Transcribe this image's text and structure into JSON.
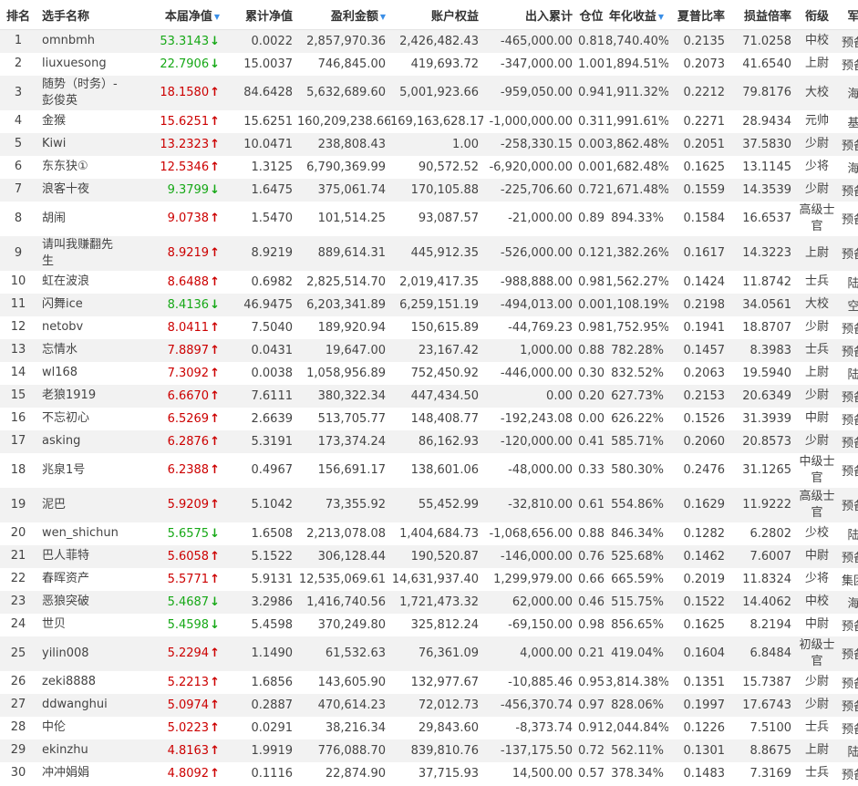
{
  "headers": {
    "rank": "排名",
    "name": "选手名称",
    "nav": "本届净值",
    "cum": "累计净值",
    "profit": "盈利金额",
    "equity": "账户权益",
    "inout": "出入累计",
    "pos": "仓位",
    "annual": "年化收益",
    "sharpe": "夏普比率",
    "plr": "损益倍率",
    "grade": "衔级",
    "branch": "军种"
  },
  "colors": {
    "up": "#cc0000",
    "down": "#16a816",
    "sort_icon": "#3a8ee6",
    "row_alt": "#f2f2f2"
  },
  "rows": [
    {
      "rank": "1",
      "name": "omnbmh",
      "nav": "53.3143",
      "dir": "down",
      "cum": "0.0022",
      "profit": "2,857,970.36",
      "equity": "2,426,482.43",
      "inout": "-465,000.00",
      "pos": "0.81",
      "annual": "8,740.40%",
      "sharpe": "0.2135",
      "plr": "71.0258",
      "grade": "中校",
      "branch": "预备役",
      "tall": false
    },
    {
      "rank": "2",
      "name": "liuxuesong",
      "nav": "22.7906",
      "dir": "down",
      "cum": "15.0037",
      "profit": "746,845.00",
      "equity": "419,693.72",
      "inout": "-347,000.00",
      "pos": "1.00",
      "annual": "1,894.51%",
      "sharpe": "0.2073",
      "plr": "41.6540",
      "grade": "上尉",
      "branch": "预备役",
      "tall": false
    },
    {
      "rank": "3",
      "name": "随势（时务）-彭俊英",
      "nav": "18.1580",
      "dir": "up",
      "cum": "84.6428",
      "profit": "5,632,689.60",
      "equity": "5,001,923.66",
      "inout": "-959,050.00",
      "pos": "0.94",
      "annual": "1,911.32%",
      "sharpe": "0.2212",
      "plr": "79.8176",
      "grade": "大校",
      "branch": "海军",
      "tall": true
    },
    {
      "rank": "4",
      "name": "金猴",
      "nav": "15.6251",
      "dir": "up",
      "cum": "15.6251",
      "profit": "160,209,238.66",
      "equity": "169,163,628.17",
      "inout": "-1,000,000.00",
      "pos": "0.31",
      "annual": "1,991.61%",
      "sharpe": "0.2271",
      "plr": "28.9434",
      "grade": "元帅",
      "branch": "基金",
      "tall": false
    },
    {
      "rank": "5",
      "name": "Kiwi",
      "nav": "13.2323",
      "dir": "up",
      "cum": "10.0471",
      "profit": "238,808.43",
      "equity": "1.00",
      "inout": "-258,330.15",
      "pos": "0.00",
      "annual": "3,862.48%",
      "sharpe": "0.2051",
      "plr": "37.5830",
      "grade": "少尉",
      "branch": "预备役",
      "tall": false
    },
    {
      "rank": "6",
      "name": "东东㹟①",
      "nav": "12.5346",
      "dir": "up",
      "cum": "1.3125",
      "profit": "6,790,369.99",
      "equity": "90,572.52",
      "inout": "-6,920,000.00",
      "pos": "0.00",
      "annual": "1,682.48%",
      "sharpe": "0.1625",
      "plr": "13.1145",
      "grade": "少将",
      "branch": "海军",
      "tall": false
    },
    {
      "rank": "7",
      "name": "浪客十夜",
      "nav": "9.3799",
      "dir": "down",
      "cum": "1.6475",
      "profit": "375,061.74",
      "equity": "170,105.88",
      "inout": "-225,706.60",
      "pos": "0.72",
      "annual": "1,671.48%",
      "sharpe": "0.1559",
      "plr": "14.3539",
      "grade": "少尉",
      "branch": "预备役",
      "tall": false
    },
    {
      "rank": "8",
      "name": "胡闹",
      "nav": "9.0738",
      "dir": "up",
      "cum": "1.5470",
      "profit": "101,514.25",
      "equity": "93,087.57",
      "inout": "-21,000.00",
      "pos": "0.89",
      "annual": "894.33%",
      "sharpe": "0.1584",
      "plr": "16.6537",
      "grade": "高级士官",
      "branch": "预备役",
      "tall": true
    },
    {
      "rank": "9",
      "name": "请叫我赚翻先生",
      "nav": "8.9219",
      "dir": "up",
      "cum": "8.9219",
      "profit": "889,614.31",
      "equity": "445,912.35",
      "inout": "-526,000.00",
      "pos": "0.12",
      "annual": "1,382.26%",
      "sharpe": "0.1617",
      "plr": "14.3223",
      "grade": "上尉",
      "branch": "预备役",
      "tall": true
    },
    {
      "rank": "10",
      "name": "虹在波浪",
      "nav": "8.6488",
      "dir": "up",
      "cum": "0.6982",
      "profit": "2,825,514.70",
      "equity": "2,019,417.35",
      "inout": "-988,888.00",
      "pos": "0.98",
      "annual": "1,562.27%",
      "sharpe": "0.1424",
      "plr": "11.8742",
      "grade": "士兵",
      "branch": "陆军",
      "tall": false
    },
    {
      "rank": "11",
      "name": "闪舞ice",
      "nav": "8.4136",
      "dir": "down",
      "cum": "46.9475",
      "profit": "6,203,341.89",
      "equity": "6,259,151.19",
      "inout": "-494,013.00",
      "pos": "0.00",
      "annual": "1,108.19%",
      "sharpe": "0.2198",
      "plr": "34.0561",
      "grade": "大校",
      "branch": "空军",
      "tall": false
    },
    {
      "rank": "12",
      "name": "netobv",
      "nav": "8.0411",
      "dir": "up",
      "cum": "7.5040",
      "profit": "189,920.94",
      "equity": "150,615.89",
      "inout": "-44,769.23",
      "pos": "0.98",
      "annual": "1,752.95%",
      "sharpe": "0.1941",
      "plr": "18.8707",
      "grade": "少尉",
      "branch": "预备役",
      "tall": false
    },
    {
      "rank": "13",
      "name": "忘情水",
      "nav": "7.8897",
      "dir": "up",
      "cum": "0.0431",
      "profit": "19,647.00",
      "equity": "23,167.42",
      "inout": "1,000.00",
      "pos": "0.88",
      "annual": "782.28%",
      "sharpe": "0.1457",
      "plr": "8.3983",
      "grade": "士兵",
      "branch": "预备役",
      "tall": false
    },
    {
      "rank": "14",
      "name": "wl168",
      "nav": "7.3092",
      "dir": "up",
      "cum": "0.0038",
      "profit": "1,058,956.89",
      "equity": "752,450.92",
      "inout": "-446,000.00",
      "pos": "0.30",
      "annual": "832.52%",
      "sharpe": "0.2063",
      "plr": "19.5940",
      "grade": "上尉",
      "branch": "陆军",
      "tall": false
    },
    {
      "rank": "15",
      "name": "老狼1919",
      "nav": "6.6670",
      "dir": "up",
      "cum": "7.6111",
      "profit": "380,322.34",
      "equity": "447,434.50",
      "inout": "0.00",
      "pos": "0.20",
      "annual": "627.73%",
      "sharpe": "0.2153",
      "plr": "20.6349",
      "grade": "少尉",
      "branch": "预备役",
      "tall": false
    },
    {
      "rank": "16",
      "name": "不忘初心",
      "nav": "6.5269",
      "dir": "up",
      "cum": "2.6639",
      "profit": "513,705.77",
      "equity": "148,408.77",
      "inout": "-192,243.08",
      "pos": "0.00",
      "annual": "626.22%",
      "sharpe": "0.1526",
      "plr": "31.3939",
      "grade": "中尉",
      "branch": "预备役",
      "tall": false
    },
    {
      "rank": "17",
      "name": "asking",
      "nav": "6.2876",
      "dir": "up",
      "cum": "5.3191",
      "profit": "173,374.24",
      "equity": "86,162.93",
      "inout": "-120,000.00",
      "pos": "0.41",
      "annual": "585.71%",
      "sharpe": "0.2060",
      "plr": "20.8573",
      "grade": "少尉",
      "branch": "预备役",
      "tall": false
    },
    {
      "rank": "18",
      "name": "兆泉1号",
      "nav": "6.2388",
      "dir": "up",
      "cum": "0.4967",
      "profit": "156,691.17",
      "equity": "138,601.06",
      "inout": "-48,000.00",
      "pos": "0.33",
      "annual": "580.30%",
      "sharpe": "0.2476",
      "plr": "31.1265",
      "grade": "中级士官",
      "branch": "预备役",
      "tall": true
    },
    {
      "rank": "19",
      "name": "泥巴",
      "nav": "5.9209",
      "dir": "up",
      "cum": "5.1042",
      "profit": "73,355.92",
      "equity": "55,452.99",
      "inout": "-32,810.00",
      "pos": "0.61",
      "annual": "554.86%",
      "sharpe": "0.1629",
      "plr": "11.9222",
      "grade": "高级士官",
      "branch": "预备役",
      "tall": true
    },
    {
      "rank": "20",
      "name": "wen_shichun",
      "nav": "5.6575",
      "dir": "down",
      "cum": "1.6508",
      "profit": "2,213,078.08",
      "equity": "1,404,684.73",
      "inout": "-1,068,656.00",
      "pos": "0.88",
      "annual": "846.34%",
      "sharpe": "0.1282",
      "plr": "6.2802",
      "grade": "少校",
      "branch": "陆军",
      "tall": false
    },
    {
      "rank": "21",
      "name": "巴人菲特",
      "nav": "5.6058",
      "dir": "up",
      "cum": "5.1522",
      "profit": "306,128.44",
      "equity": "190,520.87",
      "inout": "-146,000.00",
      "pos": "0.76",
      "annual": "525.68%",
      "sharpe": "0.1462",
      "plr": "7.6007",
      "grade": "中尉",
      "branch": "预备役",
      "tall": false
    },
    {
      "rank": "22",
      "name": "春晖资产",
      "nav": "5.5771",
      "dir": "up",
      "cum": "5.9131",
      "profit": "12,535,069.61",
      "equity": "14,631,937.40",
      "inout": "1,299,979.00",
      "pos": "0.66",
      "annual": "665.59%",
      "sharpe": "0.2019",
      "plr": "11.8324",
      "grade": "少将",
      "branch": "集团军",
      "tall": false
    },
    {
      "rank": "23",
      "name": "恶狼突破",
      "nav": "5.4687",
      "dir": "down",
      "cum": "3.2986",
      "profit": "1,416,740.56",
      "equity": "1,721,473.32",
      "inout": "62,000.00",
      "pos": "0.46",
      "annual": "515.75%",
      "sharpe": "0.1522",
      "plr": "14.4062",
      "grade": "中校",
      "branch": "海军",
      "tall": false
    },
    {
      "rank": "24",
      "name": "世贝",
      "nav": "5.4598",
      "dir": "down",
      "cum": "5.4598",
      "profit": "370,249.80",
      "equity": "325,812.24",
      "inout": "-69,150.00",
      "pos": "0.98",
      "annual": "856.65%",
      "sharpe": "0.1625",
      "plr": "8.2194",
      "grade": "中尉",
      "branch": "预备役",
      "tall": false
    },
    {
      "rank": "25",
      "name": "yilin008",
      "nav": "5.2294",
      "dir": "up",
      "cum": "1.1490",
      "profit": "61,532.63",
      "equity": "76,361.09",
      "inout": "4,000.00",
      "pos": "0.21",
      "annual": "419.04%",
      "sharpe": "0.1604",
      "plr": "6.8484",
      "grade": "初级士官",
      "branch": "预备役",
      "tall": true
    },
    {
      "rank": "26",
      "name": "zeki8888",
      "nav": "5.2213",
      "dir": "up",
      "cum": "1.6856",
      "profit": "143,605.90",
      "equity": "132,977.67",
      "inout": "-10,885.46",
      "pos": "0.95",
      "annual": "3,814.38%",
      "sharpe": "0.1351",
      "plr": "15.7387",
      "grade": "少尉",
      "branch": "预备役",
      "tall": false
    },
    {
      "rank": "27",
      "name": "ddwanghui",
      "nav": "5.0974",
      "dir": "up",
      "cum": "0.2887",
      "profit": "470,614.23",
      "equity": "72,012.73",
      "inout": "-456,370.74",
      "pos": "0.97",
      "annual": "828.06%",
      "sharpe": "0.1997",
      "plr": "17.6743",
      "grade": "少尉",
      "branch": "预备役",
      "tall": false
    },
    {
      "rank": "28",
      "name": "中伦",
      "nav": "5.0223",
      "dir": "up",
      "cum": "0.0291",
      "profit": "38,216.34",
      "equity": "29,843.60",
      "inout": "-8,373.74",
      "pos": "0.91",
      "annual": "2,044.84%",
      "sharpe": "0.1226",
      "plr": "7.5100",
      "grade": "士兵",
      "branch": "预备役",
      "tall": false
    },
    {
      "rank": "29",
      "name": "ekinzhu",
      "nav": "4.8163",
      "dir": "up",
      "cum": "1.9919",
      "profit": "776,088.70",
      "equity": "839,810.76",
      "inout": "-137,175.50",
      "pos": "0.72",
      "annual": "562.11%",
      "sharpe": "0.1301",
      "plr": "8.8675",
      "grade": "上尉",
      "branch": "陆军",
      "tall": false
    },
    {
      "rank": "30",
      "name": "冲冲娟娟",
      "nav": "4.8092",
      "dir": "up",
      "cum": "0.1116",
      "profit": "22,874.90",
      "equity": "37,715.93",
      "inout": "14,500.00",
      "pos": "0.57",
      "annual": "378.34%",
      "sharpe": "0.1483",
      "plr": "7.3169",
      "grade": "士兵",
      "branch": "预备役",
      "tall": false
    }
  ]
}
